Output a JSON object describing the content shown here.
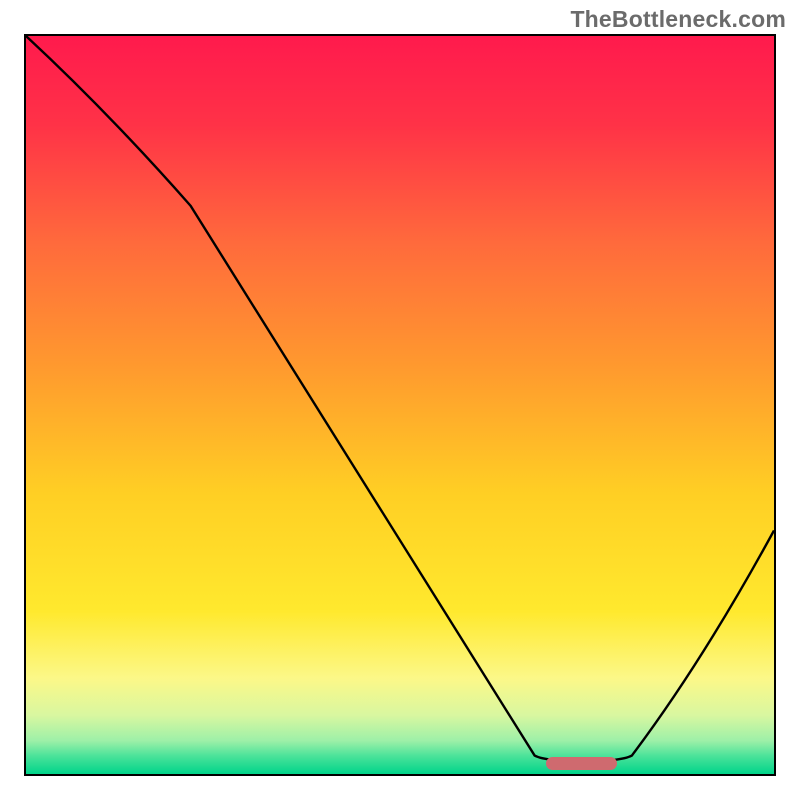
{
  "watermark": {
    "text": "TheBottleneck.com"
  },
  "colors": {
    "frame_border": "#000000",
    "curve_stroke": "#000000",
    "marker_fill": "#cf6a6f",
    "gradient_stops": [
      {
        "offset": 0.0,
        "color": "#ff1a4d"
      },
      {
        "offset": 0.12,
        "color": "#ff3247"
      },
      {
        "offset": 0.28,
        "color": "#ff6a3c"
      },
      {
        "offset": 0.45,
        "color": "#ff9a2e"
      },
      {
        "offset": 0.62,
        "color": "#ffcf24"
      },
      {
        "offset": 0.78,
        "color": "#ffe92e"
      },
      {
        "offset": 0.87,
        "color": "#fcf888"
      },
      {
        "offset": 0.92,
        "color": "#d9f7a0"
      },
      {
        "offset": 0.955,
        "color": "#9df0a8"
      },
      {
        "offset": 0.975,
        "color": "#4de39a"
      },
      {
        "offset": 1.0,
        "color": "#00d48a"
      }
    ]
  },
  "chart_data": {
    "type": "line",
    "title": "",
    "xlabel": "",
    "ylabel": "",
    "xlim": [
      0,
      100
    ],
    "ylim": [
      0,
      100
    ],
    "grid": false,
    "legend": false,
    "series": [
      {
        "name": "bottleneck-curve",
        "x": [
          0,
          22,
          68,
          74,
          81,
          100
        ],
        "y": [
          100,
          77,
          2.5,
          1.4,
          2.5,
          33
        ]
      }
    ],
    "annotations": [
      {
        "name": "valley-marker",
        "type": "bar-segment",
        "x_start": 69.5,
        "x_end": 79,
        "y": 1.4,
        "height_pct": 1.8
      }
    ],
    "background_gradient": "vertical red→orange→yellow→green"
  },
  "layout": {
    "plot_inner_w": 748,
    "plot_inner_h": 738
  }
}
